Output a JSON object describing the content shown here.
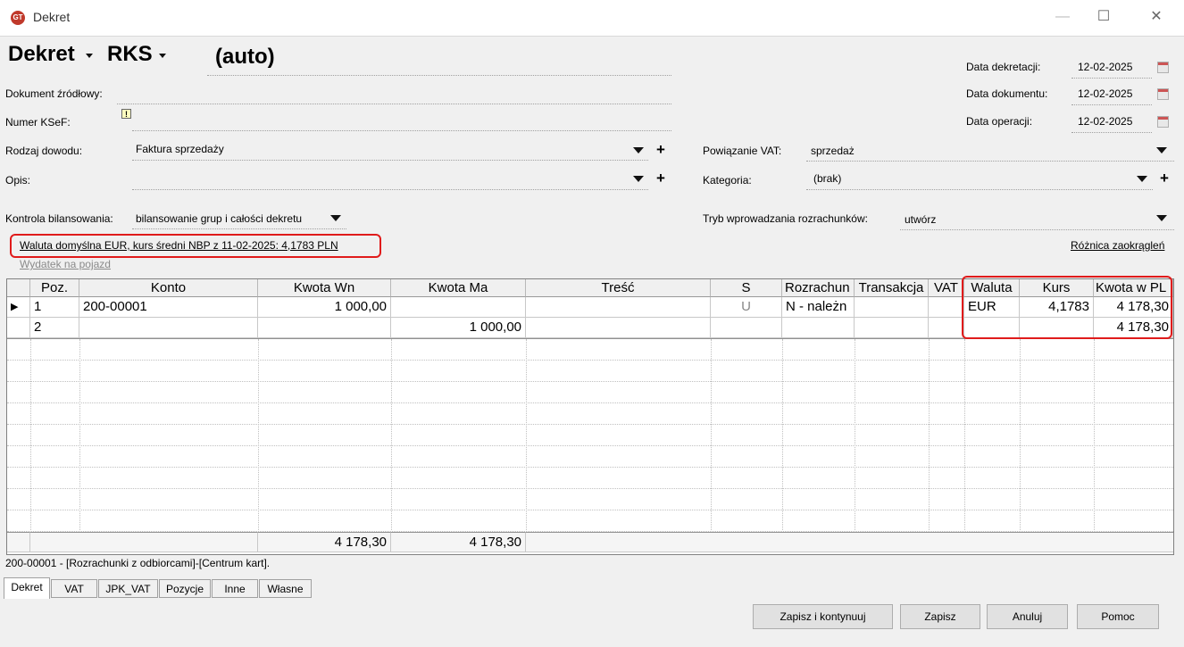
{
  "window": {
    "title": "Dekret",
    "icon": "app-logo-icon"
  },
  "header": {
    "type_label": "Dekret",
    "journal_label": "RKS",
    "number": "(auto)",
    "doc_source_label": "Dokument źródłowy:",
    "ksef_label": "Numer KSeF:",
    "proof_type_label": "Rodzaj dowodu:",
    "proof_type_value": "Faktura sprzedaży",
    "desc_label": "Opis:",
    "desc_value": "",
    "balance_label": "Kontrola bilansowania:",
    "balance_value": "bilansowanie grup i całości dekretu",
    "currency_info": "Waluta domyślna EUR, kurs średni NBP z 11-02-2025: 4,1783 PLN",
    "vehicle_link": "Wydatek na pojazd",
    "rounding_link": "Różnica zaokrągleń"
  },
  "dates": [
    {
      "label": "Data dekretacji:",
      "value": "12-02-2025"
    },
    {
      "label": "Data dokumentu:",
      "value": "12-02-2025"
    },
    {
      "label": "Data operacji:",
      "value": "12-02-2025"
    }
  ],
  "right_fields": {
    "vat_label": "Powiązanie VAT:",
    "vat_value": "sprzedaż",
    "category_label": "Kategoria:",
    "category_value": "(brak)",
    "settle_label": "Tryb wprowadzania rozrachunków:",
    "settle_value": "utwórz"
  },
  "grid": {
    "columns": [
      "Poz.",
      "Konto",
      "Kwota Wn",
      "Kwota Ma",
      "Treść",
      "S",
      "Rozrachun",
      "Transakcja",
      "VAT",
      "Waluta",
      "Kurs",
      "Kwota w PL"
    ],
    "rows": [
      {
        "poz": "1",
        "konto": "200-00001",
        "wn": "1 000,00",
        "ma": "",
        "tresc": "",
        "s": "U",
        "rozrachunek": "N - należn",
        "transakcja": "",
        "vat": "",
        "waluta": "EUR",
        "kurs": "4,1783",
        "kwota_pln": "4 178,30"
      },
      {
        "poz": "2",
        "konto": "",
        "wn": "",
        "ma": "1 000,00",
        "tresc": "",
        "s": "",
        "rozrachunek": "",
        "transakcja": "",
        "vat": "",
        "waluta": "",
        "kurs": "",
        "kwota_pln": "4 178,30"
      }
    ],
    "totals": {
      "wn": "4 178,30",
      "ma": "4 178,30"
    }
  },
  "status_text": "200-00001 - [Rozrachunki z odbiorcami]-[Centrum kart].",
  "tabs": [
    "Dekret",
    "VAT",
    "JPK_VAT",
    "Pozycje",
    "Inne",
    "Własne"
  ],
  "buttons": {
    "save_continue": "Zapisz i kontynuuj",
    "save": "Zapisz",
    "cancel": "Anuluj",
    "help": "Pomoc"
  }
}
